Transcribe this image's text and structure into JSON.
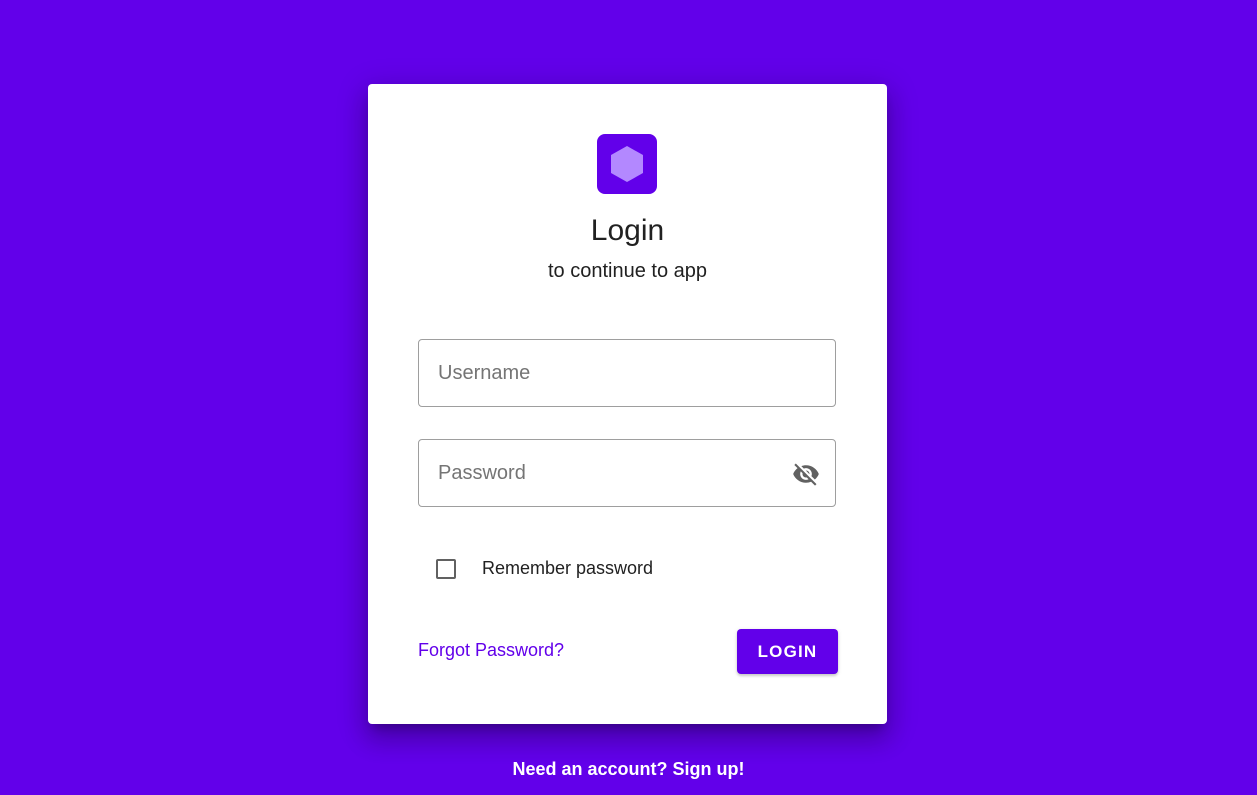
{
  "card": {
    "title": "Login",
    "subtitle": "to continue to app",
    "logo_icon": "hexagon-icon"
  },
  "form": {
    "username": {
      "placeholder": "Username",
      "value": ""
    },
    "password": {
      "placeholder": "Password",
      "value": "",
      "toggle_icon": "eye-off-icon"
    },
    "remember_label": "Remember password",
    "remember_checked": false,
    "forgot_label": "Forgot Password?",
    "login_label": "LOGIN"
  },
  "footer": {
    "signup_label": "Need an account? Sign up!"
  },
  "colors": {
    "brand": "#6200EA",
    "logo_hexagon": "#B388FF",
    "card_bg": "#FFFFFF"
  }
}
